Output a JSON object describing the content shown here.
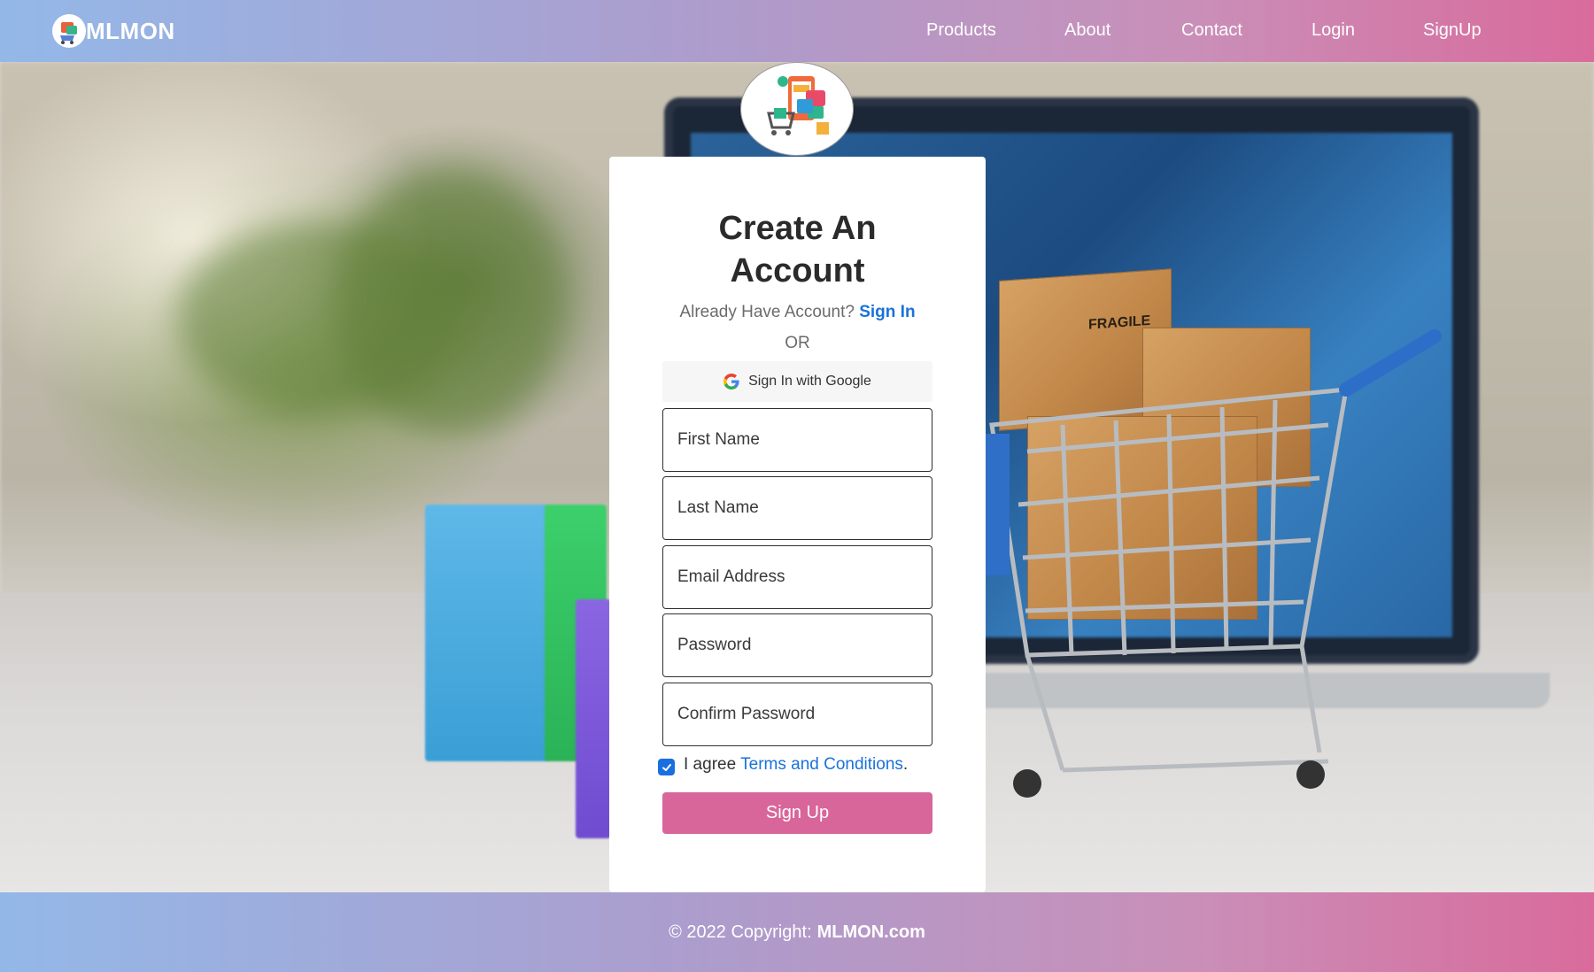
{
  "navbar": {
    "brand": "MLMON",
    "links": [
      "Products",
      "About",
      "Contact",
      "Login",
      "SignUp"
    ]
  },
  "form": {
    "title_line1": "Create An",
    "title_line2": "Account",
    "already_text": "Already Have Account?",
    "signin_link": "Sign In",
    "or_text": "OR",
    "google_button": "Sign In with Google",
    "fields": {
      "first_name_placeholder": "First Name",
      "last_name_placeholder": "Last Name",
      "email_placeholder": "Email Address",
      "password_placeholder": "Password",
      "confirm_password_placeholder": "Confirm Password"
    },
    "agree_text": "I agree",
    "terms_link": "Terms and Conditions",
    "terms_suffix": ".",
    "agree_checked": true,
    "submit_label": "Sign Up"
  },
  "footer": {
    "copyright": "© 2022 Copyright:",
    "site": "MLMON.com"
  },
  "background": {
    "box_label": "FRAGILE"
  },
  "colors": {
    "nav_gradient_start": "#93b8e8",
    "nav_gradient_end": "#d96b9c",
    "link_blue": "#1a72d9",
    "submit_pink": "#d8669a",
    "checkbox_blue": "#1a6fe0"
  },
  "icons": {
    "brand_logo": "shopping-logo-icon",
    "card_logo": "online-store-cart-icon",
    "google": "google-g-icon",
    "checkmark": "check-icon"
  }
}
